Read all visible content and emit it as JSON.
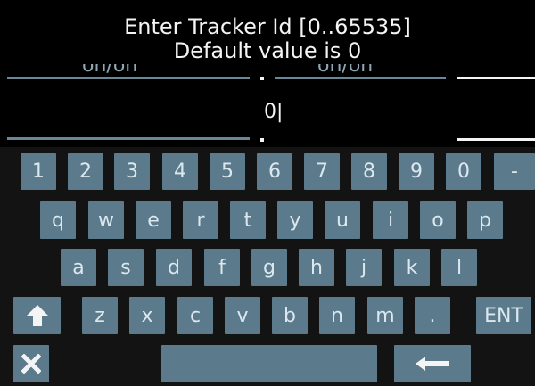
{
  "prompt": {
    "line1": "Enter Tracker Id [0..65535]",
    "line2": "Default value is 0"
  },
  "input": {
    "value": "0|"
  },
  "keyboard": {
    "row1": [
      "1",
      "2",
      "3",
      "4",
      "5",
      "6",
      "7",
      "8",
      "9",
      "0",
      "-"
    ],
    "row2": [
      "q",
      "w",
      "e",
      "r",
      "t",
      "y",
      "u",
      "i",
      "o",
      "p"
    ],
    "row3": [
      "a",
      "s",
      "d",
      "f",
      "g",
      "h",
      "j",
      "k",
      "l"
    ],
    "row4": [
      "z",
      "x",
      "c",
      "v",
      "b",
      "n",
      "m",
      "."
    ],
    "enter_label": "ENT",
    "shift_icon": "up-arrow-icon",
    "cancel_icon": "close-icon",
    "backspace_icon": "left-arrow-icon"
  },
  "colors": {
    "background": "#000000",
    "key": "#5b7a8b",
    "key_text": "#dce8ef",
    "text": "#f4f4f4"
  }
}
